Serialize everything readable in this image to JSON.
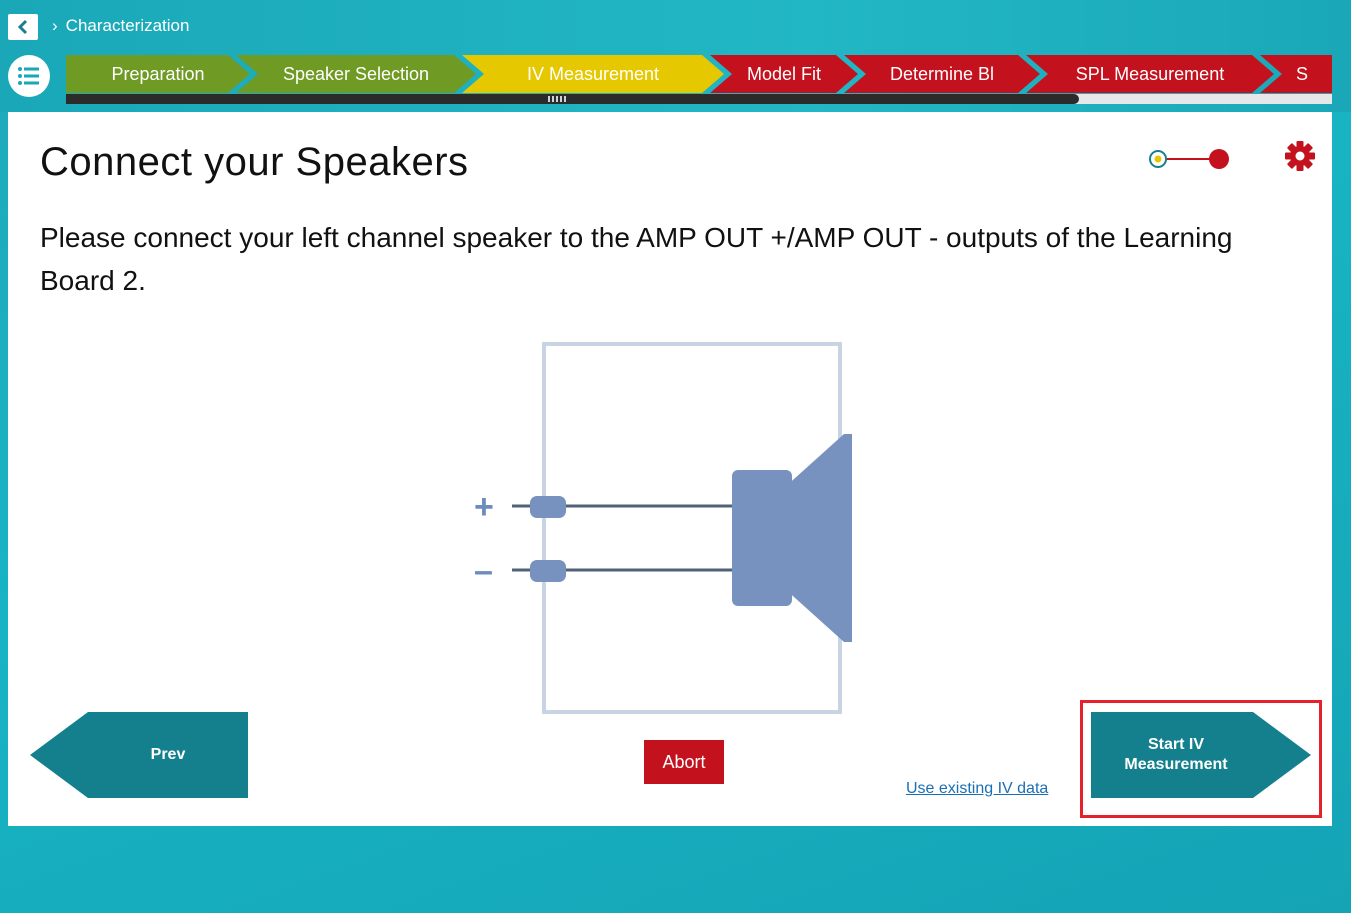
{
  "nav": {
    "back_icon": "chevron-left-icon",
    "breadcrumb_separator": "›",
    "breadcrumb": "Characterization",
    "menu_icon": "list-icon"
  },
  "steps": [
    {
      "label": "Preparation",
      "color": "#6f9a24",
      "state": "done"
    },
    {
      "label": "Speaker Selection",
      "color": "#6f9a24",
      "state": "done"
    },
    {
      "label": "IV Measurement",
      "color": "#e6c800",
      "state": "current"
    },
    {
      "label": "Model Fit",
      "color": "#c3121e",
      "state": "todo"
    },
    {
      "label": "Determine Bl",
      "color": "#c3121e",
      "state": "todo"
    },
    {
      "label": "SPL Measurement",
      "color": "#c3121e",
      "state": "todo"
    },
    {
      "label": "S",
      "color": "#c3121e",
      "state": "todo"
    }
  ],
  "progress_fraction": 0.8,
  "page": {
    "title": "Connect your Speakers",
    "instruction": "Please connect your left channel speaker to the AMP OUT +/AMP OUT - outputs of the Learning Board 2."
  },
  "diagram": {
    "plus_label": "+",
    "minus_label": "–",
    "speaker_icon": "speaker-icon"
  },
  "buttons": {
    "prev": "Prev",
    "abort": "Abort",
    "start_line1": "Start IV",
    "start_line2": "Measurement",
    "use_existing": "Use existing IV data"
  },
  "colors": {
    "teal_button": "#14808e",
    "abort_red": "#c3121e",
    "highlight_red": "#e3222b",
    "step_green": "#6f9a24",
    "step_yellow": "#e6c800",
    "step_red": "#c3121e"
  }
}
